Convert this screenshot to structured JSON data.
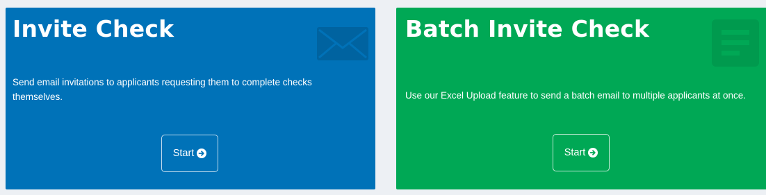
{
  "cards": [
    {
      "title": "Invite Check",
      "description": "Send email invitations to applicants requesting them to complete checks themselves.",
      "button_label": "Start",
      "icon": "envelope-icon",
      "color": "#0072b8"
    },
    {
      "title": "Batch Invite Check",
      "description": "Use our Excel Upload feature to send a batch email to multiple applicants at once.",
      "button_label": "Start",
      "icon": "document-list-icon",
      "color": "#00a855"
    }
  ],
  "colors": {
    "page_background": "#edf0f4",
    "text": "#ffffff"
  }
}
